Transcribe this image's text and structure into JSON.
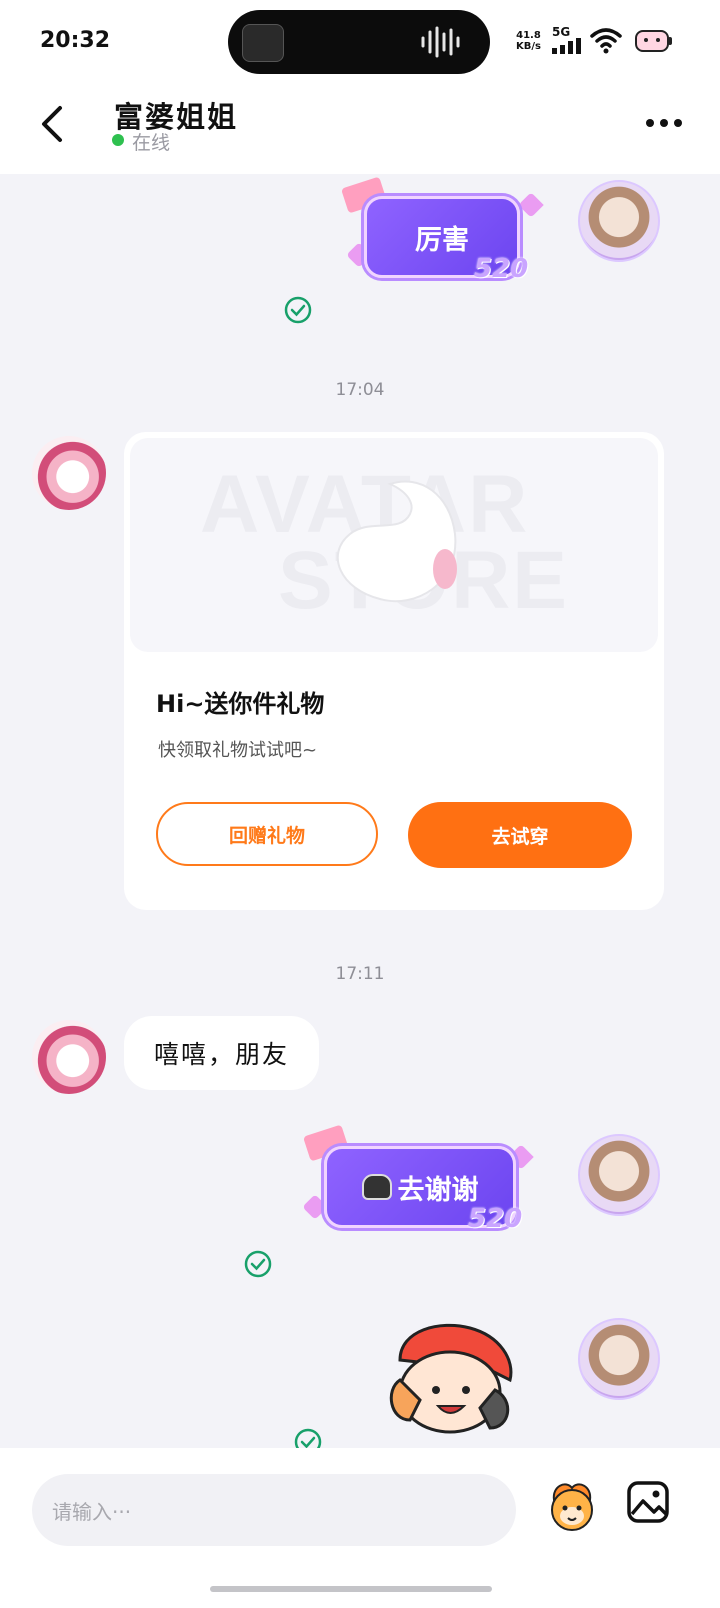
{
  "status_bar": {
    "time": "20:32",
    "speed_value": "41.8",
    "speed_unit": "KB/s",
    "network": "5G"
  },
  "header": {
    "title": "富婆姐姐",
    "status": "在线"
  },
  "messages": {
    "gift1_text": "厉害",
    "gift1_number": "520",
    "timestamp1": "17:04",
    "card_watermark_line1": "AVATAR",
    "card_watermark_line2": "STORE",
    "card_title": "Hi~送你件礼物",
    "card_subtitle": "快领取礼物试试吧~",
    "card_button_return": "回赠礼物",
    "card_button_try": "去试穿",
    "timestamp2": "17:11",
    "text_message": "嘻嘻，朋友",
    "gift2_text": "去谢谢",
    "gift2_number": "520"
  },
  "input": {
    "placeholder": "请输入···"
  },
  "colors": {
    "accent": "#ff7012",
    "online": "#2ec04f",
    "read_check": "#18a06a",
    "gift_purple": "#7a52f5"
  }
}
